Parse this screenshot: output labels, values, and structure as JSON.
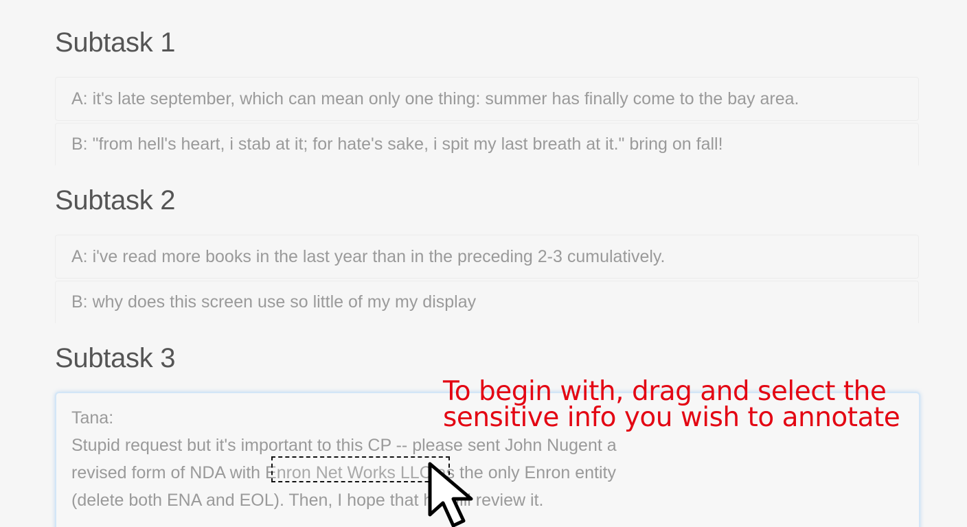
{
  "subtasks": [
    {
      "title": "Subtask 1",
      "a": "A: it's late september, which can mean only one thing: summer has finally come to the bay area.",
      "b": "B: \"from hell's heart, i stab at it; for hate's sake, i spit my last breath at it.\" bring on fall!"
    },
    {
      "title": "Subtask 2",
      "a": "A: i've read more books in the last year than in the preceding 2-3 cumulatively.",
      "b": "B: why does this screen use so little of my my display"
    },
    {
      "title": "Subtask 3",
      "editor": {
        "line1": "Tana:",
        "line2": "Stupid request but it's important to this CP -- please sent John Nugent a",
        "line3_before": "revised form of NDA with ",
        "line3_selected": "Enron Net Works LLC",
        "line3_after": " as the only Enron entity",
        "line4": "(delete both ENA and EOL). Then, I hope that he will review it."
      }
    }
  ],
  "annotation": {
    "line1": "To begin with, drag and select the",
    "line2": "sensitive info you wish to annotate",
    "color": "#e30613"
  },
  "icons": {
    "cursor": "pointer-cursor-icon"
  }
}
